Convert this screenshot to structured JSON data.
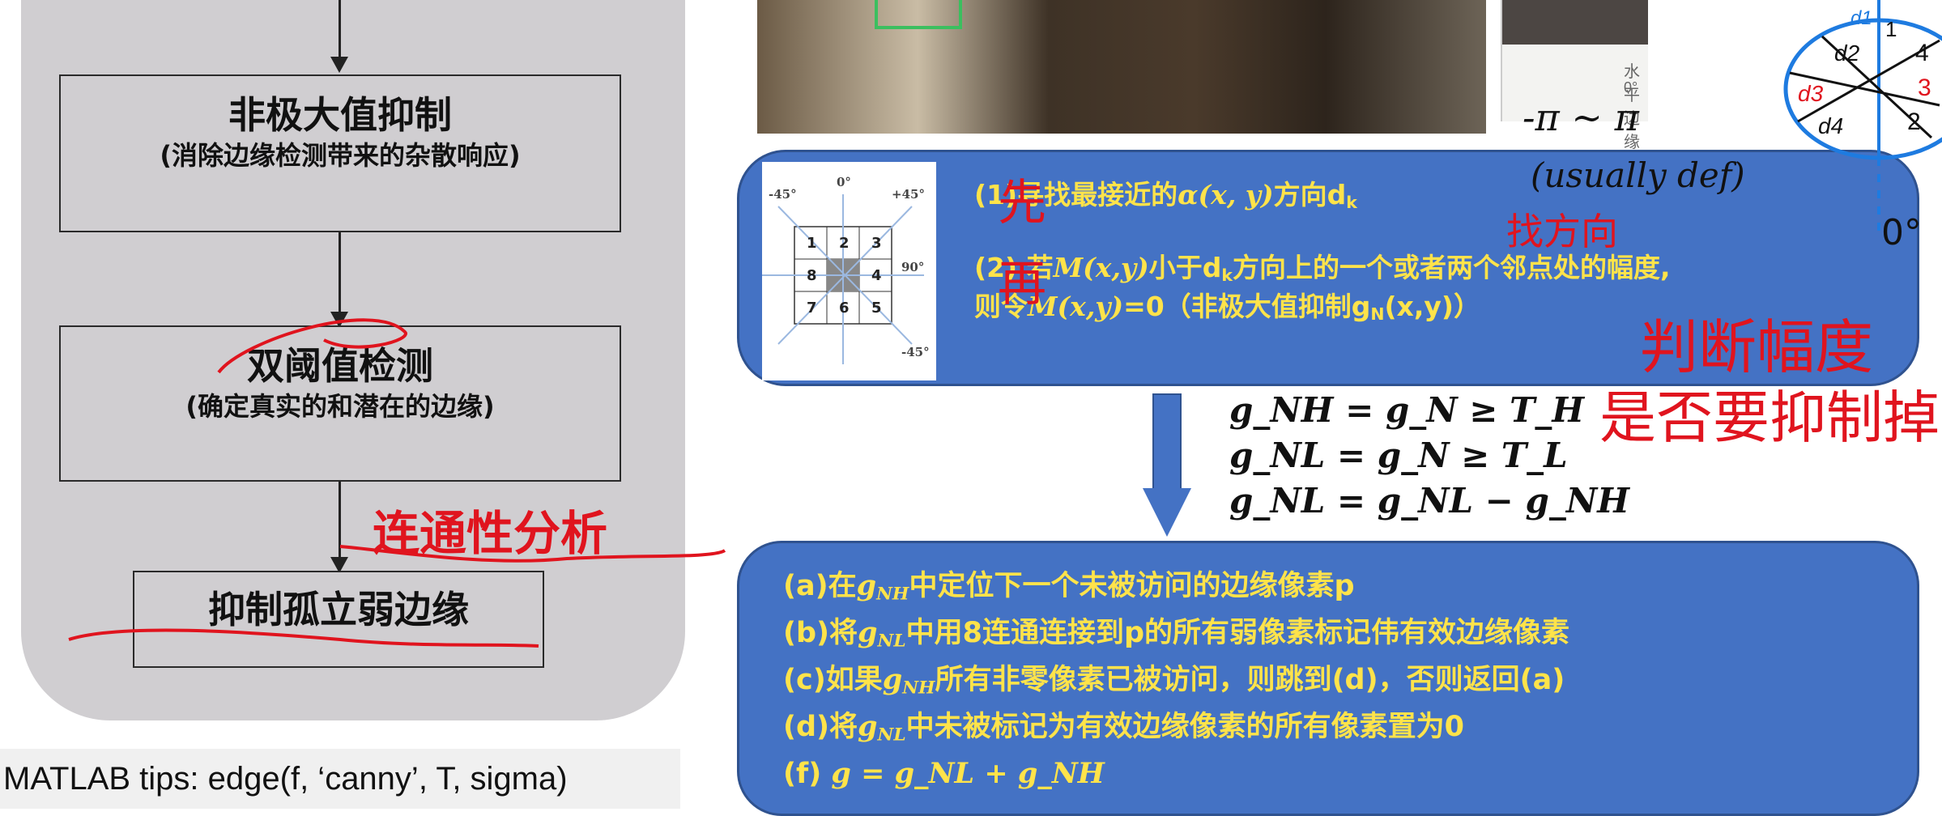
{
  "flowchart": {
    "box_nms_title": "非极大值抑制",
    "box_nms_sub": "(消除边缘检测带来的杂散响应)",
    "box_dt_title": "双阈值检测",
    "box_dt_sub": "(确定真实的和潜在的边缘)",
    "box_weak_title": "抑制孤立弱边缘",
    "annotation": "连通性分析"
  },
  "tips": "MATLAB tips: edge(f, ‘canny’, T, sigma)",
  "photo_label": "水平边缘",
  "photo_deg": "0°",
  "grid": {
    "labels_top": [
      "-45°",
      "0°",
      "+45°"
    ],
    "right_labels": [
      "90°",
      "-45°"
    ],
    "cells": [
      "1",
      "2",
      "3",
      "8",
      "",
      "4",
      "7",
      "6",
      "5"
    ]
  },
  "box1": {
    "step1_a": "(1)寻找最接近的",
    "step1_alpha": "α(x, y)",
    "step1_b": "方向d",
    "step1_sub": "k",
    "step2_a": "(2) 若",
    "step2_m": "M(x,y)",
    "step2_b": "小于d",
    "step2_sub": "k",
    "step2_c": "方向上的一个或者两个邻点处的幅度,",
    "step3_a": "则令",
    "step3_m": "M(x,y)",
    "step3_b": "=0（非极大值抑制g",
    "step3_sub": "N",
    "step3_c": "(x,y)）"
  },
  "formulas": [
    "g_NH = g_N ≥ T_H",
    "g_NL = g_N ≥ T_L",
    "g_NL = g_NL − g_NH"
  ],
  "box2": {
    "a_pre": "(a)在",
    "a_var": "g",
    "a_sub": "NH",
    "a_post": "中定位下一个未被访问的边缘像素p",
    "b_pre": "(b)将",
    "b_var": "g",
    "b_sub": "NL",
    "b_post": "中用8连通连接到p的所有弱像素标记伟有效边缘像素",
    "c_pre": "(c)如果",
    "c_var": "g",
    "c_sub": "NH",
    "c_post": "所有非零像素已被访问，则跳到(d)，否则返回(a)",
    "d_pre": "(d)将",
    "d_var": "g",
    "d_sub": "NL",
    "d_post": "中未被标记为有效边缘像素的所有像素置为0",
    "f_pre": "(f) ",
    "f_formula": "g = g_NL + g_NH"
  },
  "handwriting": {
    "first": "先",
    "then": "再",
    "range": "-π ~ π",
    "usually": "(usually def)",
    "find_dir": "找方向",
    "judge": "判断幅度",
    "suppress": "是否要抑制掉",
    "zero_deg": "0°",
    "wheel": [
      "d1",
      "d2",
      "d3",
      "d4",
      "1",
      "2",
      "3",
      "4"
    ]
  },
  "colors": {
    "panel": "#d0ced1",
    "blue_box": "#4472c4",
    "yellow_text": "#ffe34a",
    "red_ink": "#e0141e",
    "blue_ink": "#1e7be0"
  }
}
